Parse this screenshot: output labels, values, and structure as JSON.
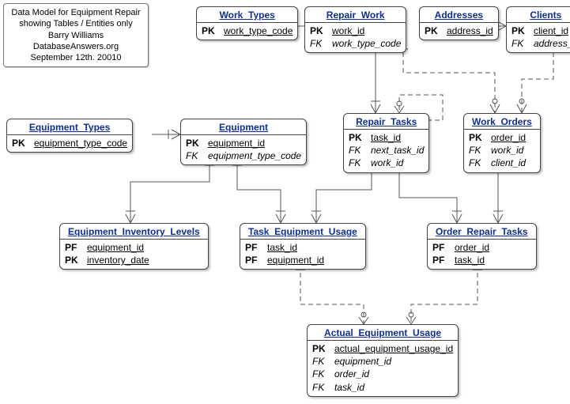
{
  "info": {
    "line1": "Data Model for Equipment Repair",
    "line2": "showing Tables / Entities only",
    "line3": "Barry Williams",
    "line4": "DatabaseAnswers.org",
    "line5": "September 12th. 20010"
  },
  "entities": {
    "work_types": {
      "title": "Work_Types",
      "rows": [
        {
          "k": "PK",
          "a": "work_type_code",
          "pk": true
        }
      ]
    },
    "repair_work": {
      "title": "Repair_Work",
      "rows": [
        {
          "k": "PK",
          "a": "work_id",
          "pk": true
        },
        {
          "k": "FK",
          "a": "work_type_code",
          "fk": true
        }
      ]
    },
    "addresses": {
      "title": "Addresses",
      "rows": [
        {
          "k": "PK",
          "a": "address_id",
          "pk": true
        }
      ]
    },
    "clients": {
      "title": "Clients",
      "rows": [
        {
          "k": "PK",
          "a": "client_id",
          "pk": true
        },
        {
          "k": "FK",
          "a": "address_id",
          "fk": true
        }
      ]
    },
    "equipment_types": {
      "title": "Equipment_Types",
      "rows": [
        {
          "k": "PK",
          "a": "equipment_type_code",
          "pk": true
        }
      ]
    },
    "equipment": {
      "title": "Equipment",
      "rows": [
        {
          "k": "PK",
          "a": "equipment_id",
          "pk": true
        },
        {
          "k": "FK",
          "a": "equipment_type_code",
          "fk": true
        }
      ]
    },
    "repair_tasks": {
      "title": "Repair_Tasks",
      "rows": [
        {
          "k": "PK",
          "a": "task_id",
          "pk": true
        },
        {
          "k": "FK",
          "a": "next_task_id",
          "fk": true
        },
        {
          "k": "FK",
          "a": "work_id",
          "fk": true
        }
      ]
    },
    "work_orders": {
      "title": "Work_Orders",
      "rows": [
        {
          "k": "PK",
          "a": "order_id",
          "pk": true
        },
        {
          "k": "FK",
          "a": "work_id",
          "fk": true
        },
        {
          "k": "FK",
          "a": "client_id",
          "fk": true
        }
      ]
    },
    "eq_inventory": {
      "title": "Equipment_Inventory_Levels",
      "rows": [
        {
          "k": "PF",
          "a": "equipment_id",
          "pk": true
        },
        {
          "k": "PK",
          "a": "inventory_date",
          "pk": true
        }
      ]
    },
    "task_eq_usage": {
      "title": "Task_Equipment_Usage",
      "rows": [
        {
          "k": "PF",
          "a": "task_id",
          "pk": true
        },
        {
          "k": "PF",
          "a": "equipment_id",
          "pk": true
        }
      ]
    },
    "order_repair_tasks": {
      "title": "Order_Repair_Tasks",
      "rows": [
        {
          "k": "PF",
          "a": "order_id",
          "pk": true
        },
        {
          "k": "PF",
          "a": "task_id",
          "pk": true
        }
      ]
    },
    "actual_eq_usage": {
      "title": "Actual_Equipment_Usage",
      "rows": [
        {
          "k": "PK",
          "a": "actual_equipment_usage_id",
          "pk": true
        },
        {
          "k": "FK",
          "a": "equipment_id",
          "fk": true
        },
        {
          "k": "FK",
          "a": "order_id",
          "fk": true
        },
        {
          "k": "FK",
          "a": "task_id",
          "fk": true
        }
      ]
    }
  },
  "relationships": [
    {
      "from": "Repair_Work",
      "to": "Work_Types",
      "via": "work_type_code",
      "card": "many-to-one"
    },
    {
      "from": "Clients",
      "to": "Addresses",
      "via": "address_id",
      "card": "many-to-one"
    },
    {
      "from": "Equipment",
      "to": "Equipment_Types",
      "via": "equipment_type_code",
      "card": "many-to-one"
    },
    {
      "from": "Repair_Tasks",
      "to": "Repair_Work",
      "via": "work_id",
      "card": "many-to-one"
    },
    {
      "from": "Repair_Tasks",
      "to": "Repair_Tasks",
      "via": "next_task_id",
      "card": "self one-to-one/many"
    },
    {
      "from": "Work_Orders",
      "to": "Repair_Work",
      "via": "work_id",
      "card": "many-to-one"
    },
    {
      "from": "Work_Orders",
      "to": "Clients",
      "via": "client_id",
      "card": "many-to-one"
    },
    {
      "from": "Equipment_Inventory_Levels",
      "to": "Equipment",
      "via": "equipment_id",
      "card": "many-to-one"
    },
    {
      "from": "Task_Equipment_Usage",
      "to": "Equipment",
      "via": "equipment_id",
      "card": "many-to-one"
    },
    {
      "from": "Task_Equipment_Usage",
      "to": "Repair_Tasks",
      "via": "task_id",
      "card": "many-to-one"
    },
    {
      "from": "Order_Repair_Tasks",
      "to": "Repair_Tasks",
      "via": "task_id",
      "card": "many-to-one"
    },
    {
      "from": "Order_Repair_Tasks",
      "to": "Work_Orders",
      "via": "order_id",
      "card": "many-to-one"
    },
    {
      "from": "Actual_Equipment_Usage",
      "to": "Task_Equipment_Usage",
      "via": "task_id,equipment_id",
      "card": "many-to-one",
      "identifying": false
    },
    {
      "from": "Actual_Equipment_Usage",
      "to": "Order_Repair_Tasks",
      "via": "order_id,task_id",
      "card": "many-to-one",
      "identifying": false
    }
  ]
}
